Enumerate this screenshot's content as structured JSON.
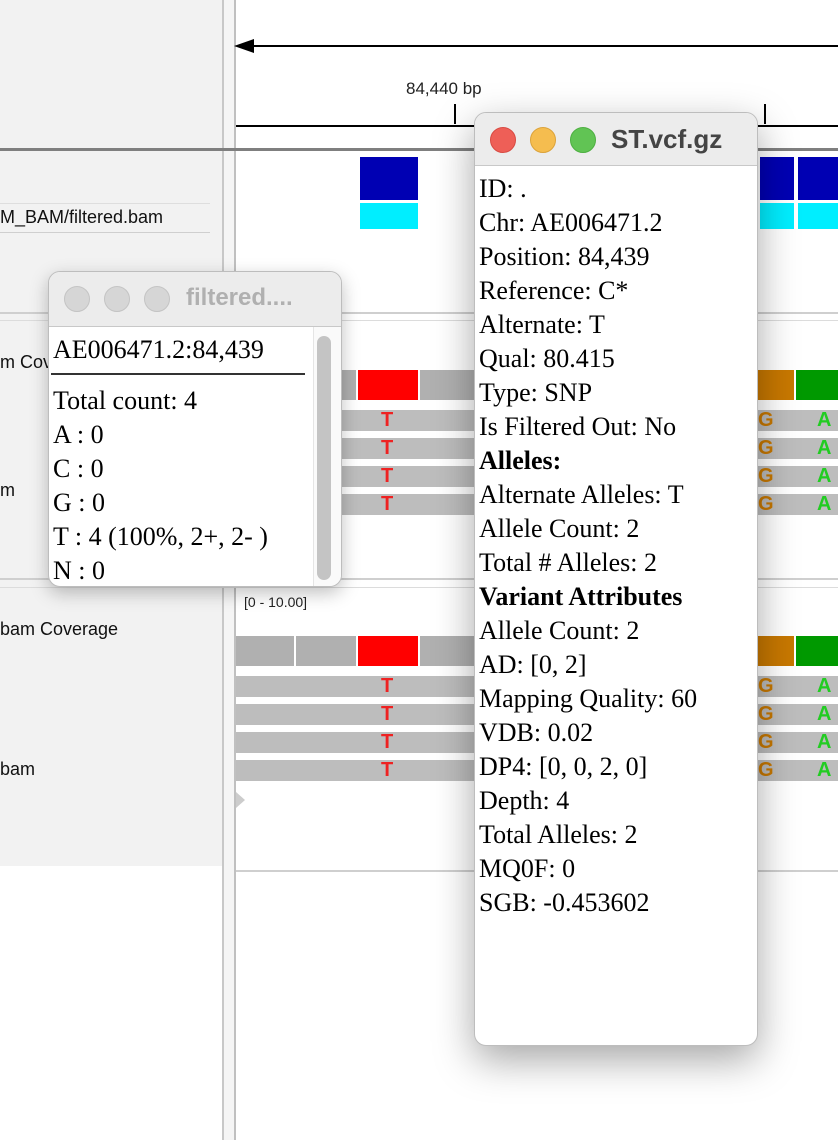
{
  "ruler": {
    "position_label": "84,440 bp"
  },
  "tracks": {
    "sample_path": "M_BAM/filtered.bam",
    "coverage1_label": "m Cov",
    "reads1_label": "m",
    "coverage2_label": "bam Coverage",
    "reads2_label": "bam",
    "coverage_range": "[0 - 10.00]",
    "bases": {
      "ref_alt": "T",
      "g": "G",
      "a": "A"
    }
  },
  "filtered_popup": {
    "title": "filtered....",
    "locus": "AE006471.2:84,439",
    "lines": [
      "Total count: 4",
      "A : 0",
      "C : 0",
      "G : 0",
      "T : 4 (100%, 2+, 2- )",
      "N : 0"
    ]
  },
  "vcf_popup": {
    "title": "ST.vcf.gz",
    "lines": [
      {
        "text": "ID: .",
        "bold": false
      },
      {
        "text": "Chr: AE006471.2",
        "bold": false
      },
      {
        "text": "Position: 84,439",
        "bold": false
      },
      {
        "text": "Reference: C*",
        "bold": false
      },
      {
        "text": "Alternate: T",
        "bold": false
      },
      {
        "text": "Qual: 80.415",
        "bold": false
      },
      {
        "text": "Type: SNP",
        "bold": false
      },
      {
        "text": "Is Filtered Out: No",
        "bold": false
      },
      {
        "text": "Alleles:",
        "bold": true
      },
      {
        "text": "Alternate Alleles: T",
        "bold": false
      },
      {
        "text": "Allele Count: 2",
        "bold": false
      },
      {
        "text": "Total # Alleles: 2",
        "bold": false
      },
      {
        "text": "Variant Attributes",
        "bold": true
      },
      {
        "text": "Allele Count: 2",
        "bold": false
      },
      {
        "text": "AD: [0, 2]",
        "bold": false
      },
      {
        "text": "Mapping Quality: 60",
        "bold": false
      },
      {
        "text": "VDB: 0.02",
        "bold": false
      },
      {
        "text": "DP4: [0, 0, 2, 0]",
        "bold": false
      },
      {
        "text": "Depth: 4",
        "bold": false
      },
      {
        "text": "Total Alleles: 2",
        "bold": false
      },
      {
        "text": "MQ0F: 0",
        "bold": false
      },
      {
        "text": "SGB: -0.453602",
        "bold": false
      }
    ]
  },
  "colors": {
    "window_close": "#ee5f57",
    "window_minimize": "#f5bd4f",
    "window_zoom": "#61c454",
    "window_inactive": "#d6d6d6"
  }
}
